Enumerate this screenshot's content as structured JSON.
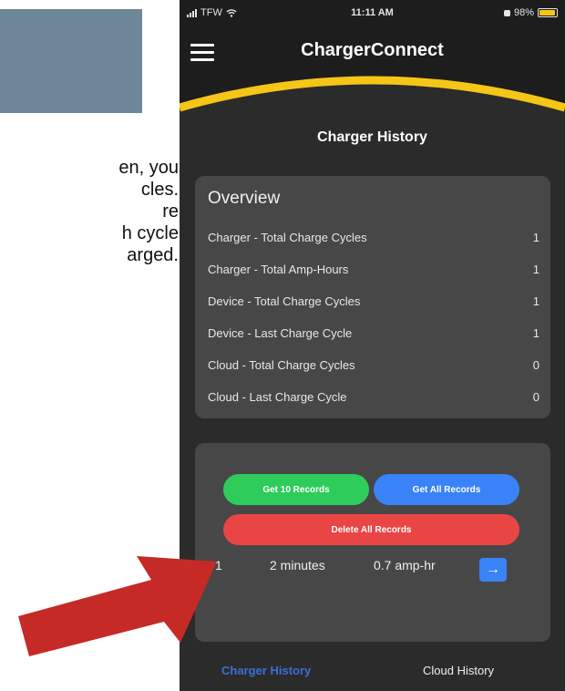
{
  "document": {
    "text_lines": [
      "en, you",
      "cles.",
      "re",
      "h cycle",
      "arged."
    ]
  },
  "status_bar": {
    "carrier": "TFW",
    "time": "11:11 AM",
    "battery": "98%"
  },
  "header": {
    "title": "ChargerConnect"
  },
  "page": {
    "section_title": "Charger History"
  },
  "overview": {
    "title": "Overview",
    "rows": [
      {
        "label": "Charger - Total Charge Cycles",
        "value": "1"
      },
      {
        "label": "Charger - Total Amp-Hours",
        "value": "1"
      },
      {
        "label": "Device - Total Charge Cycles",
        "value": "1"
      },
      {
        "label": "Device - Last Charge Cycle",
        "value": "1"
      },
      {
        "label": "Cloud - Total Charge Cycles",
        "value": "0"
      },
      {
        "label": "Cloud - Last Charge Cycle",
        "value": "0"
      }
    ]
  },
  "records": {
    "get_10_label": "Get 10 Records",
    "get_all_label": "Get All Records",
    "delete_all_label": "Delete All Records",
    "record": {
      "index": "1",
      "duration": "2 minutes",
      "amp_hours": "0.7 amp-hr"
    }
  },
  "tabs": {
    "charger_history": "Charger History",
    "cloud_history": "Cloud History"
  },
  "colors": {
    "accent_yellow": "#f5c518",
    "green_button": "#2ecc5b",
    "blue_button": "#3a82f7",
    "red_button": "#ea4545",
    "annotation_arrow": "#c62a26"
  },
  "icons": {
    "menu": "hamburger-menu-icon",
    "next": "arrow-right-icon",
    "wifi": "wifi-icon",
    "battery": "battery-icon",
    "annotation": "red-pointer-arrow"
  }
}
